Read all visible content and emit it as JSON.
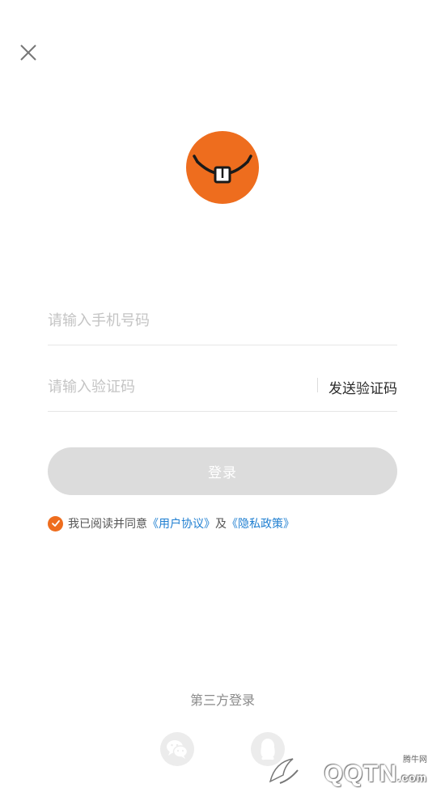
{
  "form": {
    "phone_placeholder": "请输入手机号码",
    "code_placeholder": "请输入验证码",
    "send_code_label": "发送验证码",
    "login_label": "登录"
  },
  "agreement": {
    "checked": true,
    "prefix": "我已阅读并同意",
    "user_agreement": "《用户协议》",
    "joiner": "及",
    "privacy_policy": "《隐私政策》"
  },
  "third_party": {
    "title": "第三方登录",
    "providers": [
      "wechat-icon",
      "qq-icon"
    ]
  },
  "watermark": {
    "small": "腾牛网",
    "brand": "QQTN",
    "suffix": ".com"
  },
  "colors": {
    "accent": "#ee6d1e",
    "link": "#1f7fd1",
    "button_disabled": "#dcdcdc"
  }
}
